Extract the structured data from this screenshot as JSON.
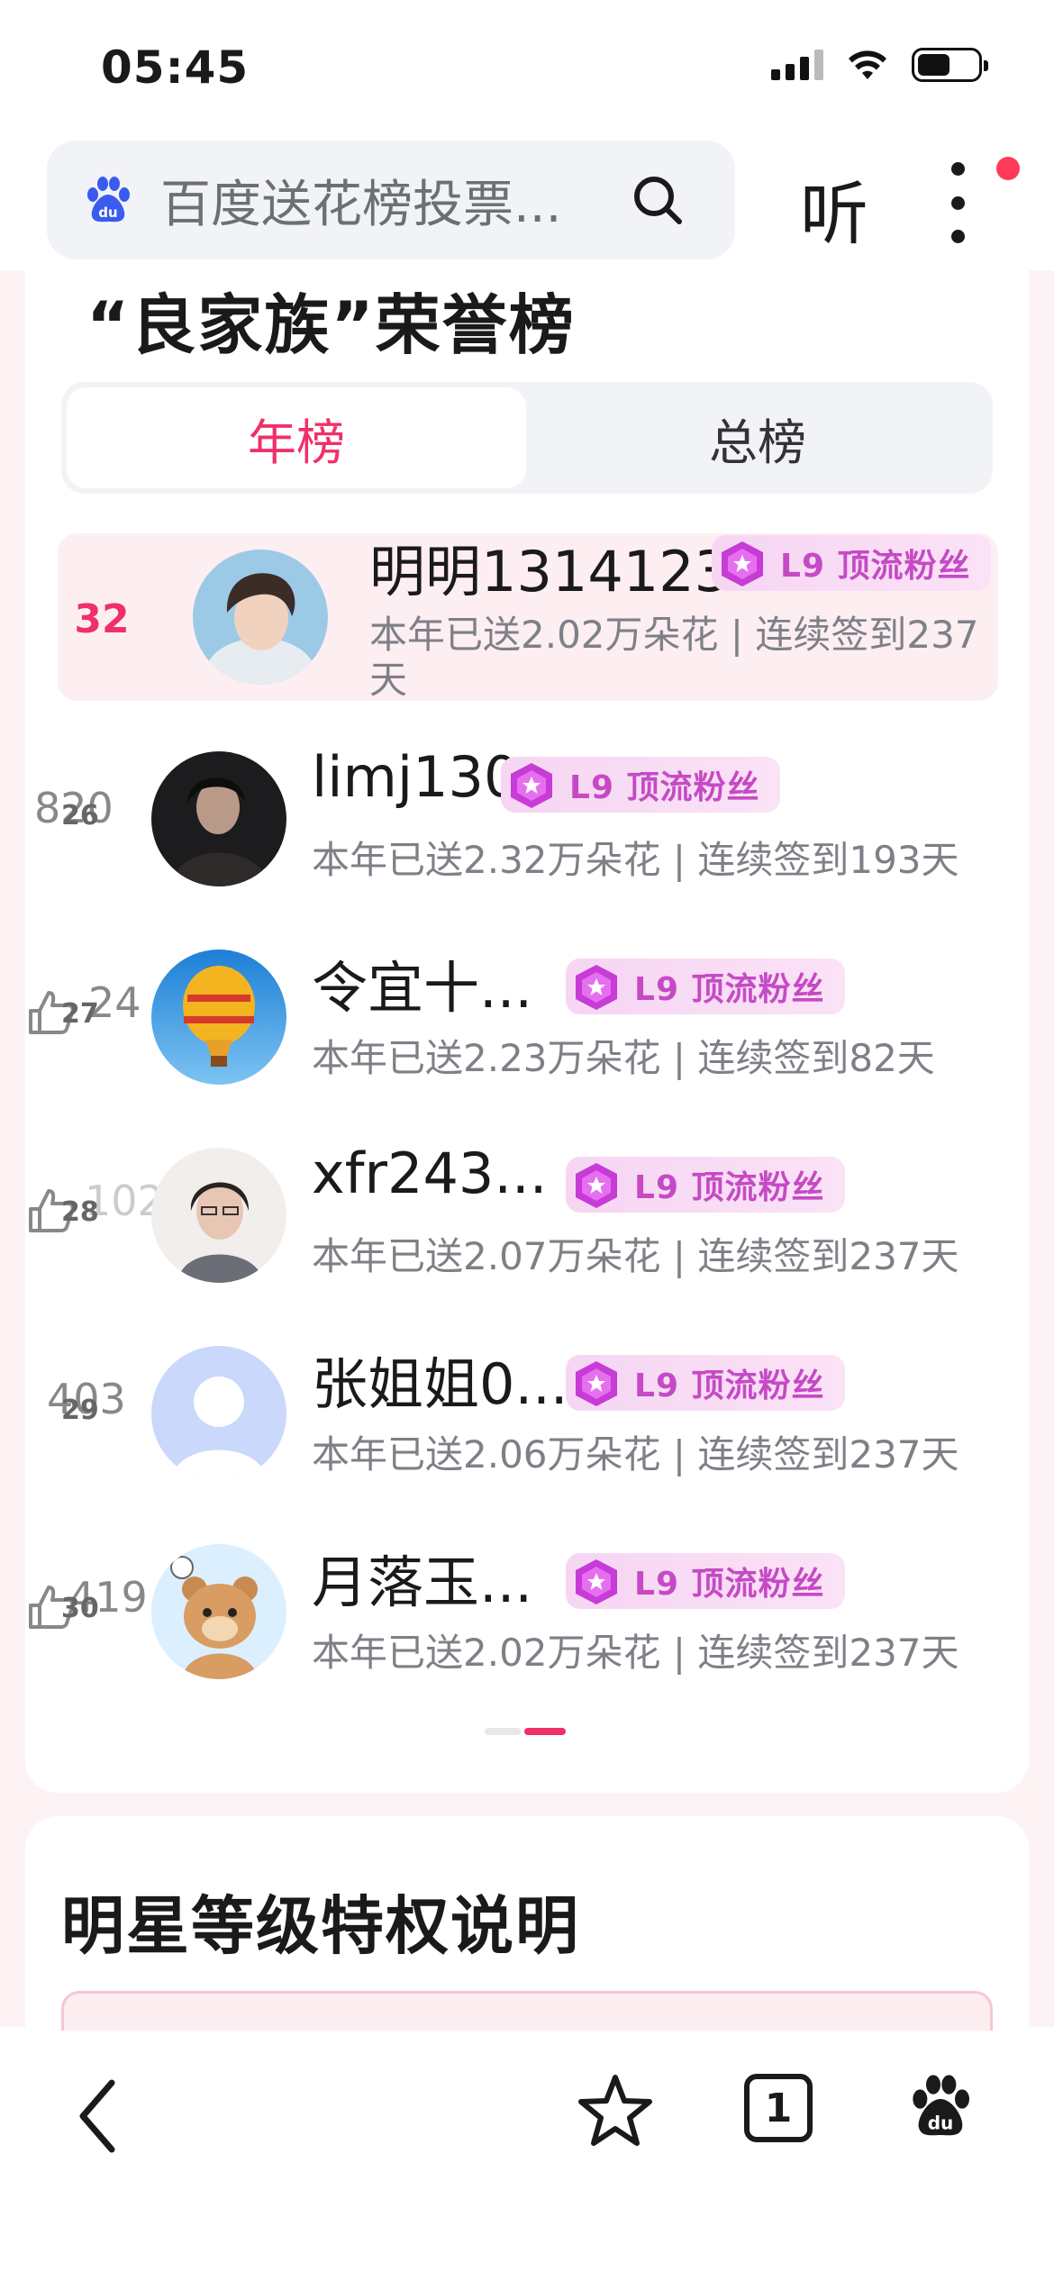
{
  "status_bar": {
    "time": "05:45"
  },
  "search": {
    "placeholder_text": "百度送花榜投票...",
    "listen_label": "听"
  },
  "honor": {
    "title": "“良家族”荣誉榜",
    "tabs": [
      {
        "label": "年榜",
        "active": true
      },
      {
        "label": "总榜",
        "active": false
      }
    ],
    "my_entry": {
      "rank": "32",
      "name": "明明1314123",
      "badge": "L9 顶流粉丝",
      "stats": "本年已送2.02万朵花 | 连续签到237天"
    },
    "entries": [
      {
        "side_num": "820",
        "side_sub": "26",
        "name": "limj130",
        "badge": "L9 顶流粉丝",
        "stats": "本年已送2.32万朵花 | 连续签到193天",
        "avatar": "dark-portrait"
      },
      {
        "side_num": "24",
        "side_sub": "27",
        "name": "令宜十...",
        "badge": "L9 顶流粉丝",
        "stats": "本年已送2.23万朵花 | 连续签到82天",
        "avatar": "hot-air-balloon"
      },
      {
        "side_num": "102",
        "side_sub": "28",
        "name": "xfr243...",
        "badge": "L9 顶流粉丝",
        "stats": "本年已送2.07万朵花 | 连续签到237天",
        "avatar": "woman-portrait"
      },
      {
        "side_num": "403",
        "side_sub": "29",
        "name": "张姐姐0...",
        "badge": "L9 顶流粉丝",
        "stats": "本年已送2.06万朵花 | 连续签到237天",
        "avatar": "default-user"
      },
      {
        "side_num": "419",
        "side_sub": "30",
        "name": "月落玉...",
        "badge": "L9 顶流粉丝",
        "stats": "本年已送2.02万朵花 | 连续签到237天",
        "avatar": "cartoon-bear"
      }
    ]
  },
  "level_section": {
    "title": "明星等级特权说明"
  },
  "bottom_nav": {
    "tab_count": "1"
  },
  "colors": {
    "accent": "#f0306a",
    "badge_text": "#c54ac6",
    "badge_bg": "#f6d6f3"
  }
}
